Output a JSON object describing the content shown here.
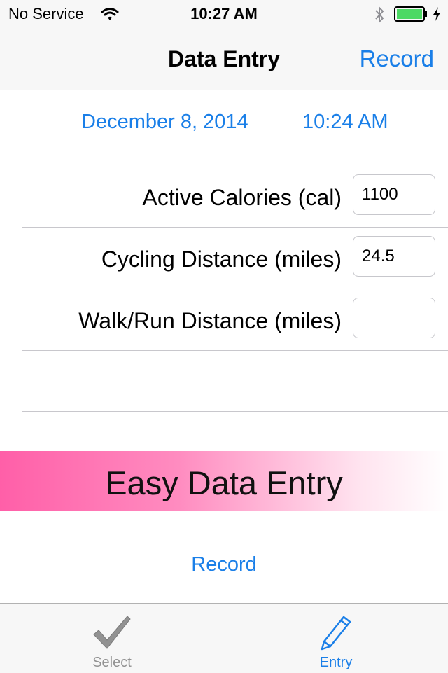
{
  "status_bar": {
    "carrier": "No Service",
    "time": "10:27 AM",
    "icons": [
      "wifi-icon",
      "bluetooth-icon",
      "battery-icon",
      "charging-icon"
    ]
  },
  "nav": {
    "title": "Data Entry",
    "record_label": "Record"
  },
  "entry": {
    "date": "December 8, 2014",
    "time": "10:24 AM",
    "rows": [
      {
        "label": "Active Calories (cal)",
        "value": "1100"
      },
      {
        "label": "Cycling Distance (miles)",
        "value": "24.5"
      },
      {
        "label": "Walk/Run Distance (miles)",
        "value": ""
      }
    ]
  },
  "banner": {
    "text": "Easy Data Entry"
  },
  "record_button": {
    "label": "Record"
  },
  "tabs": [
    {
      "label": "Select",
      "icon": "checkmark-icon",
      "selected": false
    },
    {
      "label": "Entry",
      "icon": "pencil-icon",
      "selected": true
    }
  ],
  "colors": {
    "accent": "#1a7fe8",
    "banner_start": "#ff5fa8",
    "battery": "#4cd964",
    "tab_inactive": "#929292"
  }
}
